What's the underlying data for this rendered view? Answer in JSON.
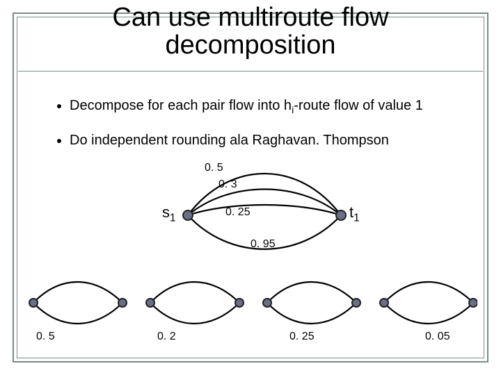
{
  "title_line1": "Can use multiroute flow",
  "title_line2": "decomposition",
  "bullets": {
    "b1_a": "Decompose for each pair flow into h",
    "b1_sub": "i",
    "b1_b": "-route flow of value 1",
    "b2": "Do independent rounding ala Raghavan. Thompson"
  },
  "main_graph": {
    "s_label": "s",
    "s_sub": "1",
    "t_label": "t",
    "t_sub": "1",
    "edge_top": "0. 5",
    "edge_mid": "0. 3",
    "edge_center": "0. 25",
    "edge_bottom": "0. 95"
  },
  "row_graphs": {
    "g1": "0. 5",
    "g2": "0. 2",
    "g3": "0. 25",
    "g4": "0. 05"
  },
  "colors": {
    "frame": "#7a8a8a",
    "node_fill": "#6b6f86",
    "node_stroke": "#222"
  }
}
